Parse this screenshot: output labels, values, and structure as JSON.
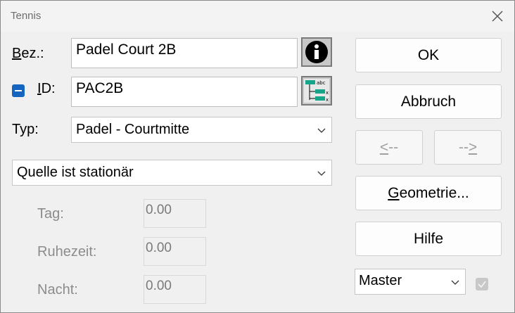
{
  "window": {
    "title": "Tennis"
  },
  "form": {
    "bez_label_accel": "B",
    "bez_label_rest": "ez.:",
    "bez_value": "Padel Court 2B",
    "id_label_accel": "I",
    "id_label_rest": "D:",
    "id_value": "PAC2B",
    "typ_label": "Typ:",
    "typ_value": "Padel - Courtmitte",
    "source_value": "Quelle ist stationär"
  },
  "periods": {
    "tag_label": "Tag:",
    "tag_value": "0.00",
    "ruhezeit_label": "Ruhezeit:",
    "ruhezeit_value": "0.00",
    "nacht_label": "Nacht:",
    "nacht_value": "0.00"
  },
  "buttons": {
    "ok": "OK",
    "cancel": "Abbruch",
    "prev_accel": "<",
    "prev_rest": "--",
    "next_rest": "--",
    "next_accel": ">",
    "geometry_accel": "G",
    "geometry_rest": "eometrie...",
    "help": "Hilfe"
  },
  "master": {
    "value": "Master"
  },
  "colors": {
    "accent": "#1565c0",
    "dialog_bg": "#f0f0f0",
    "disabled_text": "#8c8c8c"
  },
  "icons": {
    "info": "info-icon",
    "id_generator": "id-list-icon",
    "close": "close-icon"
  }
}
